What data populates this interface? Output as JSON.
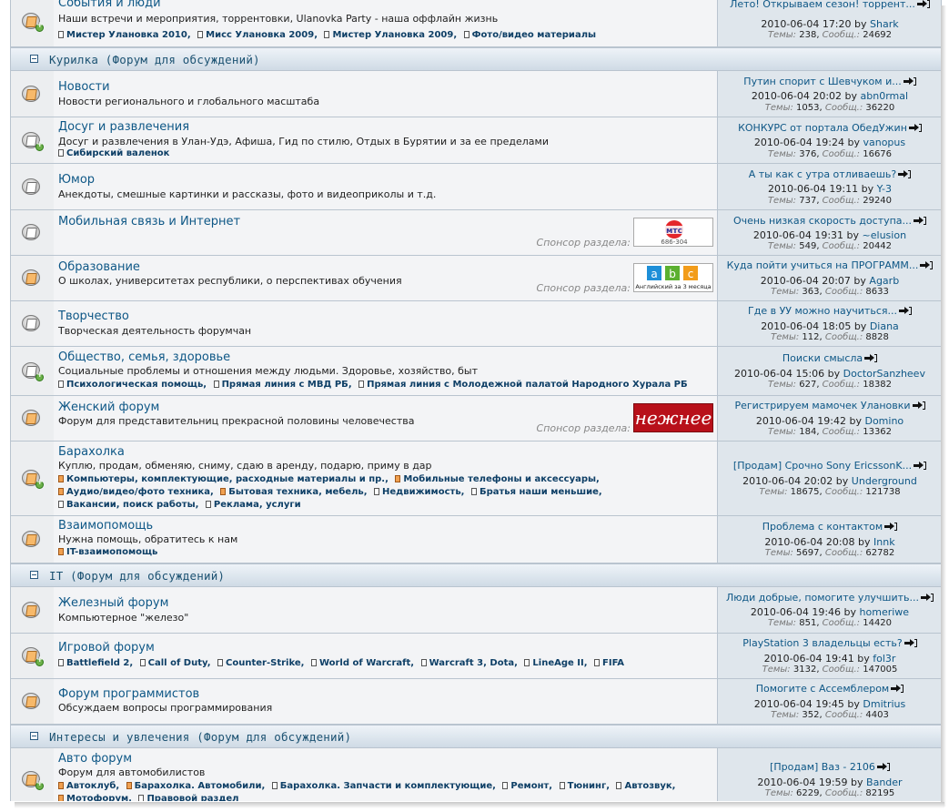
{
  "categories": [
    {
      "title": "Курилка (Форум для обсуждений)"
    },
    {
      "title": "IT (Форум для обсуждений)"
    },
    {
      "title": "Интересы и увлечения (Форум для обсуждений)"
    }
  ],
  "stats_labels": {
    "topics": "Темы:",
    "posts": "Сообщ.:",
    "by": "by"
  },
  "sponsor_label": "Спонсор раздела:",
  "forums": [
    {
      "title": "События и люди",
      "desc": "Наши встречи и мероприятия, торрентовки, Ulanovka Party - наша оффлайн жизнь",
      "subs": [
        "Мистер Улановка 2010",
        "Мисс Улановка 2009",
        "Мистер Улановка 2009",
        "Фото/видео материалы"
      ],
      "last": {
        "title": "Лето! Открываем сезон! торрент...",
        "date": "2010-06-04 17:20",
        "user": "Shark",
        "topics": "238",
        "posts": "24692"
      }
    },
    {
      "title": "Новости",
      "desc": "Новости регионального и глобального масштаба",
      "subs": [],
      "last": {
        "title": "Путин спорит с Шевчуком и...",
        "date": "2010-06-04 20:02",
        "user": "abn0rmal",
        "topics": "1053",
        "posts": "36220"
      }
    },
    {
      "title": "Досуг и развлечения",
      "desc": "Досуг и развлечения в Улан-Удэ, Афиша, Гид по стилю, Отдых в Бурятии и за ее пределами",
      "subs": [
        "Сибирский валенок"
      ],
      "last": {
        "title": "КОНКУРС от портала ОбедУжин",
        "date": "2010-06-04 19:24",
        "user": "vanopus",
        "topics": "376",
        "posts": "16676"
      }
    },
    {
      "title": "Юмор",
      "desc": "Анекдоты, смешные картинки и рассказы, фото и видеоприколы и т.д.",
      "subs": [],
      "last": {
        "title": "А ты как с утра отливаешь?",
        "date": "2010-06-04 19:11",
        "user": "Y-3",
        "topics": "737",
        "posts": "29240"
      }
    },
    {
      "title": "Мобильная связь и Интернет",
      "desc": "",
      "subs": [],
      "banner": "мтс",
      "last": {
        "title": "Очень низкая скорость доступа...",
        "date": "2010-06-04 19:31",
        "user": "~elusion",
        "topics": "549",
        "posts": "20442"
      }
    },
    {
      "title": "Образование",
      "desc": "О школах, университетах республики, о перспективах обучения",
      "subs": [],
      "banner": "abc",
      "last": {
        "title": "Куда пойти учиться на ПРОГРАММ...",
        "date": "2010-06-04 20:07",
        "user": "Agarb",
        "topics": "363",
        "posts": "8633"
      }
    },
    {
      "title": "Творчество",
      "desc": "Творческая деятельность форумчан",
      "subs": [],
      "last": {
        "title": "Где в УУ можно научиться...",
        "date": "2010-06-04 18:05",
        "user": "Diana",
        "topics": "112",
        "posts": "8828"
      }
    },
    {
      "title": "Общество, семья, здоровье",
      "desc": "Социальные проблемы и отношения между людьми. Здоровье, хозяйство, быт",
      "subs": [
        "Психологическая помощь",
        "Прямая линия с МВД РБ",
        "Прямая линия с Молодежной палатой Народного Хурала РБ"
      ],
      "last": {
        "title": "Поиски смысла",
        "date": "2010-06-04 15:06",
        "user": "DoctorSanzheev",
        "topics": "627",
        "posts": "18382"
      }
    },
    {
      "title": "Женский форум",
      "desc": "Форум для представительниц прекрасной половины человечества",
      "subs": [],
      "banner": "нежнее",
      "last": {
        "title": "Регистрируем мамочек Улановки",
        "date": "2010-06-04 19:42",
        "user": "Domino",
        "topics": "184",
        "posts": "13362"
      }
    },
    {
      "title": "Барахолка",
      "desc": "Куплю, продам, обменяю, сниму, сдаю в аренду, подарю, приму в дар",
      "subs": [
        "Компьютеры, комплектующие, расходные материалы и пр.",
        "Мобильные телефоны и аксессуары",
        "Аудио/видео/фото техника",
        "Бытовая техника, мебель",
        "Недвижимость",
        "Братья наши меньшие",
        "Вакансии, поиск работы",
        "Реклама, услуги"
      ],
      "last": {
        "title": "[Продам] Срочно Sony EricssonK...",
        "date": "2010-06-04 20:02",
        "user": "Underground",
        "topics": "18675",
        "posts": "121738"
      }
    },
    {
      "title": "Взаимопомощь",
      "desc": "Нужна помощь, обратитесь к нам",
      "subs": [
        "IT-взаимопомощь"
      ],
      "last": {
        "title": "Проблема с контактом",
        "date": "2010-06-04 20:08",
        "user": "Innk",
        "topics": "5697",
        "posts": "62782"
      }
    },
    {
      "title": "Железный форум",
      "desc": "Компьютерное \"железо\"",
      "subs": [],
      "last": {
        "title": "Люди добрые, помогите улучшить...",
        "date": "2010-06-04 19:46",
        "user": "homeriwe",
        "topics": "851",
        "posts": "14420"
      }
    },
    {
      "title": "Игровой форум",
      "desc": "",
      "subs": [
        "Battlefield 2",
        "Call of Duty",
        "Counter-Strike",
        "World of Warcraft",
        "Warcraft 3, Dota",
        "LineAge II",
        "FIFA"
      ],
      "last": {
        "title": "PlayStation 3 владельцы есть?",
        "date": "2010-06-04 19:41",
        "user": "fol3r",
        "topics": "3132",
        "posts": "147005"
      }
    },
    {
      "title": "Форум программистов",
      "desc": "Обсуждаем вопросы программирования",
      "subs": [],
      "last": {
        "title": "Помогите с Ассемблером",
        "date": "2010-06-04 19:45",
        "user": "Dmitrius",
        "topics": "352",
        "posts": "4403"
      }
    },
    {
      "title": "Авто форум",
      "desc": "Форум для автомобилистов",
      "subs": [
        "Автоклуб",
        "Барахолка. Автомобили",
        "Барахолка. Запчасти и комплектующие",
        "Ремонт",
        "Тюнинг",
        "Автозвук",
        "Мотофорум",
        "Правовой раздел"
      ],
      "last": {
        "title": "[Продам] Ваз - 2106",
        "date": "2010-06-04 19:59",
        "user": "Bander",
        "topics": "6229",
        "posts": "82195"
      }
    }
  ]
}
